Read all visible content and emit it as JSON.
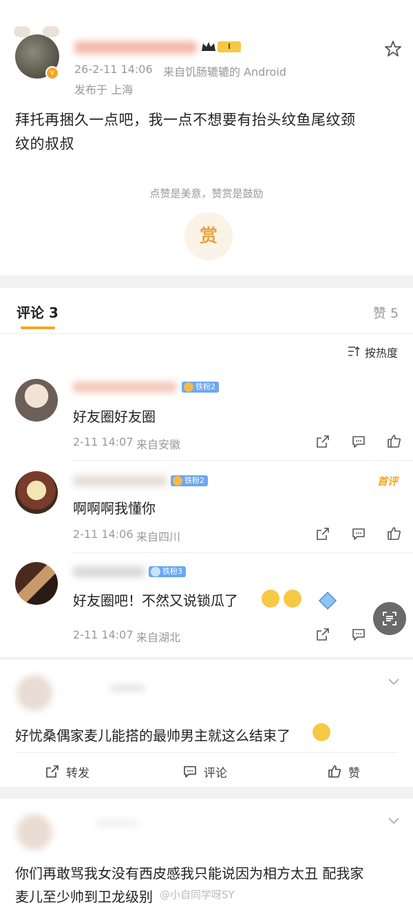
{
  "post": {
    "meta_time": "26-2-11 14:06",
    "meta_source": "来自饥肠辘辘的 Android",
    "location": "发布于 上海",
    "vip_level": "I",
    "text_line1": "拜托再捆久一点吧，我一点不想要有抬头纹鱼尾纹颈",
    "text_line2": "纹的叔叔",
    "reward_slogan": "点赞是美意，赞赏是鼓励",
    "reward_label": "赏"
  },
  "comments_header": {
    "comments_label": "评论 3",
    "likes_label": "赞 5",
    "sort_label": "按热度"
  },
  "comments": [
    {
      "badge": "铁粉2",
      "text": "好友圈好友圈",
      "time": "2-11 14:07",
      "source": "来自安徽"
    },
    {
      "badge": "铁粉2",
      "text": "啊啊啊我懂你",
      "time": "2-11 14:06",
      "source": "来自四川",
      "tag": "首评"
    },
    {
      "badge": "铁粉3",
      "text": "好友圈吧！不然又说锁瓜了",
      "time": "2-11 14:07",
      "source": "来自湖北"
    }
  ],
  "feed_post_1": {
    "text": "好忧桑偶家麦儿能搭的最帅男主就这么结束了",
    "repost_label": "转发",
    "comment_label": "评论",
    "like_label": "赞"
  },
  "feed_post_2": {
    "text_line1": "你们再敢骂我女没有西皮感我只能说因为相方太丑 配我家",
    "text_line2": "麦儿至少帅到卫龙级别"
  },
  "watermark": "@小自同学呀SY",
  "colors": {
    "accent_orange": "#f5a623",
    "badge_blue": "#6aa8f4",
    "gray_text": "#999999"
  }
}
